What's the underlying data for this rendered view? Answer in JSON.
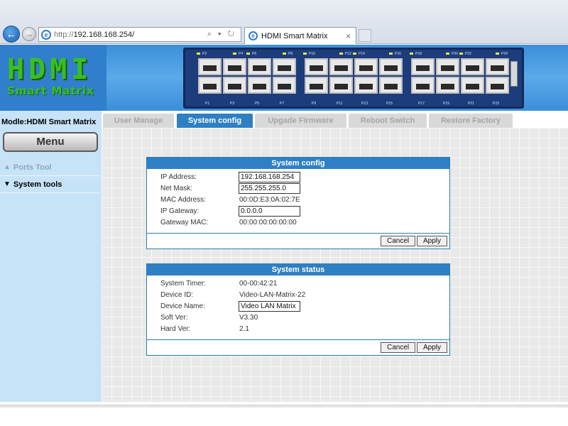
{
  "browser": {
    "url_protocol": "http://",
    "url_host": "192.168.168.254/",
    "address_tools": "⌕ ▾ ↻",
    "tab_title": "HDMI Smart Matrix",
    "tab_close": "×",
    "back_glyph": "←",
    "forward_glyph": "→",
    "ie_glyph": "e"
  },
  "header": {
    "logo_line1": "HDMI",
    "logo_line2": "Smart Matrix",
    "top_port_labels": [
      "P2",
      "P4",
      "P6",
      "P8",
      "P10",
      "P12",
      "P14",
      "P16",
      "P18",
      "P20",
      "P22",
      "P24"
    ],
    "bottom_port_labels": [
      "P1",
      "P3",
      "P5",
      "P7",
      "P9",
      "P11",
      "P13",
      "P15",
      "P17",
      "P19",
      "P21",
      "P23"
    ]
  },
  "sidebar": {
    "model": "Modle:HDMI Smart Matrix",
    "menu_label": "Menu",
    "items": [
      {
        "label": "Ports Tool",
        "arrow": "▲"
      },
      {
        "label": "System tools",
        "arrow": "▼"
      }
    ]
  },
  "tabs": [
    {
      "label": "User Manage",
      "active": false
    },
    {
      "label": "System config",
      "active": true
    },
    {
      "label": "Upgade Firmware",
      "active": false
    },
    {
      "label": "Reboot Switch",
      "active": false
    },
    {
      "label": "Restore Factory",
      "active": false
    }
  ],
  "system_config": {
    "title": "System config",
    "ip_label": "IP Address:",
    "ip_value": "192.168.168.254",
    "mask_label": "Net Mask:",
    "mask_value": "255.255.255.0",
    "mac_label": "MAC Address:",
    "mac_value": "00:0D:E3:0A:02:7E",
    "gateway_label": "IP Gateway:",
    "gateway_value": "0.0.0.0",
    "gateway_mac_label": "Gateway MAC:",
    "gateway_mac_value": "00:00:00:00:00:00",
    "cancel_label": "Cancel",
    "apply_label": "Apply"
  },
  "system_status": {
    "title": "System status",
    "timer_label": "System Timer:",
    "timer_value": "00-00:42:21",
    "device_id_label": "Device ID:",
    "device_id_value": "Video-LAN-Matrix-22",
    "device_name_label": "Device Name:",
    "device_name_value": "Video LAN Matrix",
    "soft_ver_label": "Soft Ver:",
    "soft_ver_value": "V3.30",
    "hard_ver_label": "Hard Ver:",
    "hard_ver_value": "2.1",
    "cancel_label": "Cancel",
    "apply_label": "Apply"
  },
  "colors": {
    "header_blue": "#3b8fd8",
    "logo_green": "#38c01f",
    "tab_active": "#2f7fc4",
    "sidebar_bg": "#c7e3f7"
  }
}
